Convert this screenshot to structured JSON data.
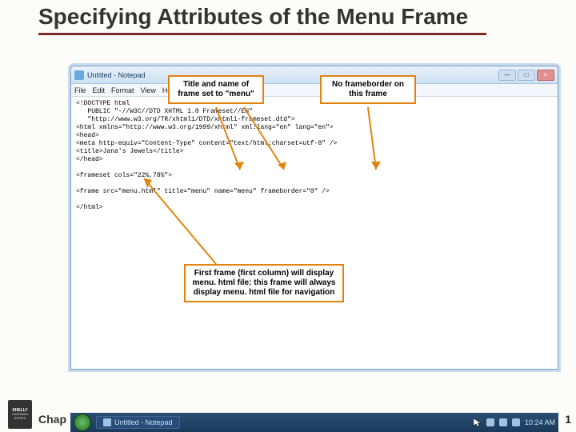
{
  "heading": "Specifying Attributes of the Menu Frame",
  "window": {
    "title": "Untitled - Notepad",
    "menu": [
      "File",
      "Edit",
      "Format",
      "View",
      "Help"
    ],
    "btn_min": "—",
    "btn_max": "□",
    "btn_close": "×"
  },
  "code": "<!DOCTYPE html\n   PUBLIC \"-//W3C//DTD XHTML 1.0 Frameset//EN\"\n   \"http://www.w3.org/TR/xhtml1/DTD/xhtml1-frameset.dtd\">\n<html xmlns=\"http://www.w3.org/1999/xhtml\" xml:lang=\"en\" lang=\"en\">\n<head>\n<meta http-equiv=\"Content-Type\" content=\"text/html;charset=utf-8\" />\n<title>Jana's Jewels</title>\n</head>\n\n<frameset cols=\"22%,78%\">\n\n<frame src=\"menu.html\" title=\"menu\" name=\"menu\" frameborder=\"0\" />\n\n</html>",
  "callouts": {
    "c1": "Title and name of frame set to \"menu\"",
    "c2": "No frameborder on this frame",
    "c3": "First frame (first column) will display menu. html file: this frame will always display menu. html file for navigation"
  },
  "taskbar": {
    "item": "Untitled - Notepad",
    "time": "10:24 AM"
  },
  "footer": "Chap",
  "page": "1",
  "series": {
    "l1": "SHELLY",
    "l2": "CASHMAN",
    "l3": "SERIES"
  }
}
